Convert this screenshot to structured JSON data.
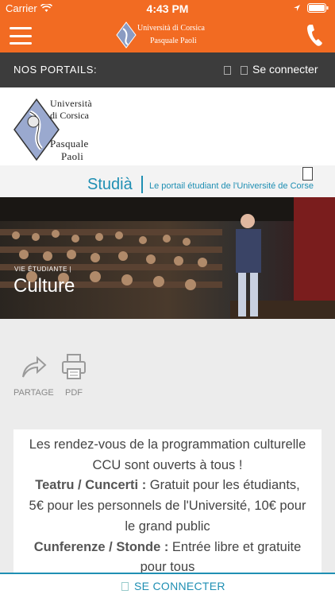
{
  "status_bar": {
    "carrier": "Carrier",
    "time": "4:43 PM"
  },
  "header": {
    "logo_line1": "Università di Corsica",
    "logo_line2": "Pasquale Paoli"
  },
  "portals_bar": {
    "label": "NOS PORTAILS",
    "colon": ":",
    "login_label": "Se connecter"
  },
  "logo": {
    "line1": "Università",
    "line2": "di Corsica",
    "line3": "Pasquale",
    "line4": "Paoli"
  },
  "studia": {
    "name": "Studià",
    "tagline": "Le portail étudiant de l'Université de Corse"
  },
  "hero": {
    "kicker": "VIE ÉTUDIANTE |",
    "title": "Culture"
  },
  "actions": {
    "share_label": "PARTAGE",
    "pdf_label": "PDF"
  },
  "content": {
    "line1": "Les rendez-vous de la programmation culturelle",
    "line2": "CCU sont ouverts à tous !",
    "line3_bold": "Teatru / Cuncerti :",
    "line3_rest": " Gratuit pour les étudiants,",
    "line4": "5€ pour les personnels de l'Université, 10€ pour",
    "line5": "le grand public",
    "line6_bold": "Cunferenze / Stonde :",
    "line6_rest": " Entrée libre et gratuite",
    "line7": "pour tous"
  },
  "bottom_bar": {
    "login_label": "SE CONNECTER"
  },
  "colors": {
    "brand_orange": "#f26b22",
    "accent_blue": "#1f8fb3",
    "dark_bar": "#3c3c3c"
  },
  "icons": [
    "menu-icon",
    "phone-icon",
    "wifi-icon",
    "location-icon",
    "battery-icon",
    "share-icon",
    "printer-icon"
  ]
}
